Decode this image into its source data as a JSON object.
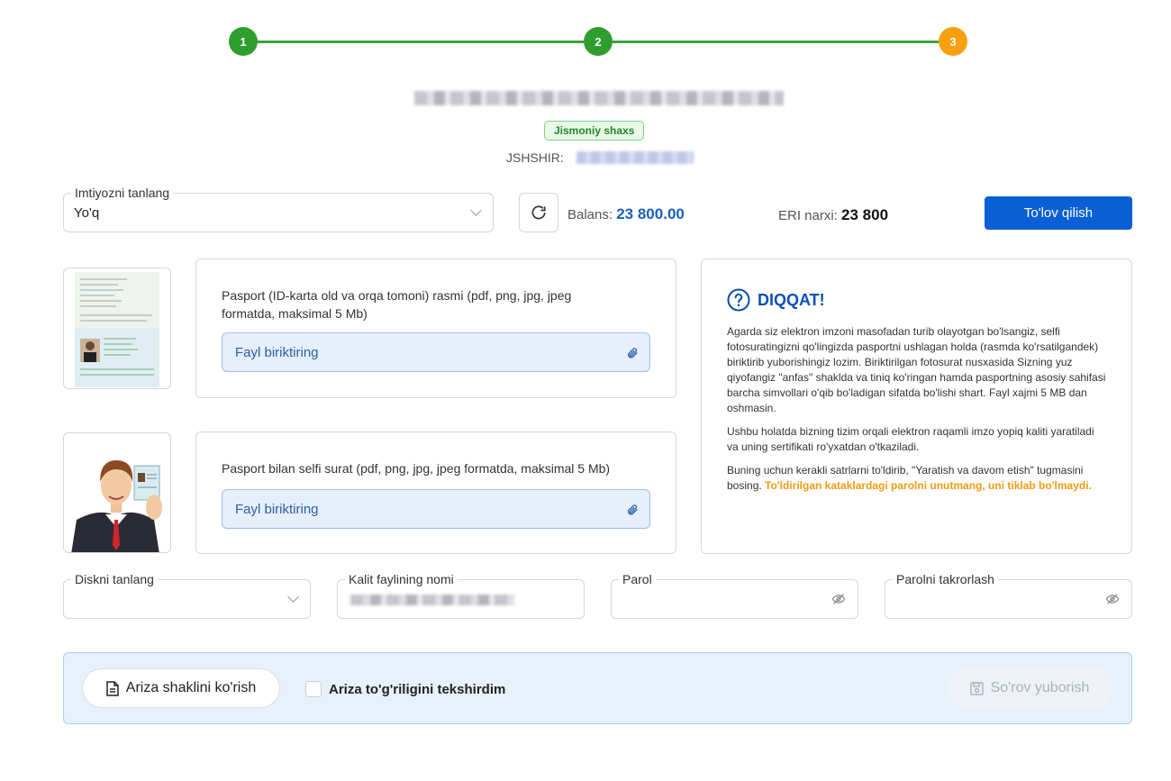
{
  "stepper": {
    "steps": [
      "1",
      "2",
      "3"
    ],
    "done_color": "#2f9e2f",
    "active_color": "#f7a00f"
  },
  "profile": {
    "type_badge": "Jismoniy shaxs",
    "jshshir_label": "JSHSHIR:"
  },
  "imtiyoz": {
    "label": "Imtiyozni tanlang",
    "value": "Yo'q"
  },
  "balance": {
    "label": "Balans:",
    "value": "23 800.00"
  },
  "eri": {
    "label": "ERI narxi:",
    "value": "23 800"
  },
  "pay_button": "To'lov qilish",
  "uploads": [
    {
      "description": "Pasport (ID-karta old va orqa tomoni) rasmi (pdf, png, jpg, jpeg formatda, maksimal 5 Mb)",
      "attach_label": "Fayl biriktiring"
    },
    {
      "description": "Pasport bilan selfi surat (pdf, png, jpg, jpeg formatda, maksimal 5 Mb)",
      "attach_label": "Fayl biriktiring"
    }
  ],
  "notice": {
    "title": "DIQQAT!",
    "p1": "Agarda siz elektron imzoni masofadan turib olayotgan bo'lsangiz, selfi fotosuratingizni qo'lingizda pasportni ushlagan holda (rasmda ko'rsatilgandek) biriktirib yuborishingiz lozim. Biriktirilgan fotosurat nusxasida Sizning yuz qiyofangiz \"anfas\" shaklda va tiniq ko'ringan hamda pasportning asosiy sahifasi barcha simvollari o'qib bo'ladigan sifatda bo'lishi shart. Fayl xajmi 5 MB dan oshmasin.",
    "p2": "Ushbu holatda bizning tizim orqali elektron raqamli imzo yopiq kaliti yaratiladi va uning sertifikati ro'yxatdan o'tkaziladi.",
    "p3": "Buning uchun kerakli satrlarni to'ldirib, \"Yaratish va davom etish\" tugmasini bosing.",
    "p3_warning": "To'ldirilgan kataklardagi parolni unutmang, uni tiklab bo'lmaydi."
  },
  "fields": {
    "disk": {
      "label": "Diskni tanlang",
      "value": ""
    },
    "key_name": {
      "label": "Kalit faylining nomi"
    },
    "password": {
      "label": "Parol"
    },
    "password_repeat": {
      "label": "Parolni takrorlash"
    }
  },
  "bottom": {
    "view_form": "Ariza shaklini ko'rish",
    "checkbox_label": "Ariza to'g'riligini tekshirdim",
    "send": "So'rov yuborish"
  }
}
